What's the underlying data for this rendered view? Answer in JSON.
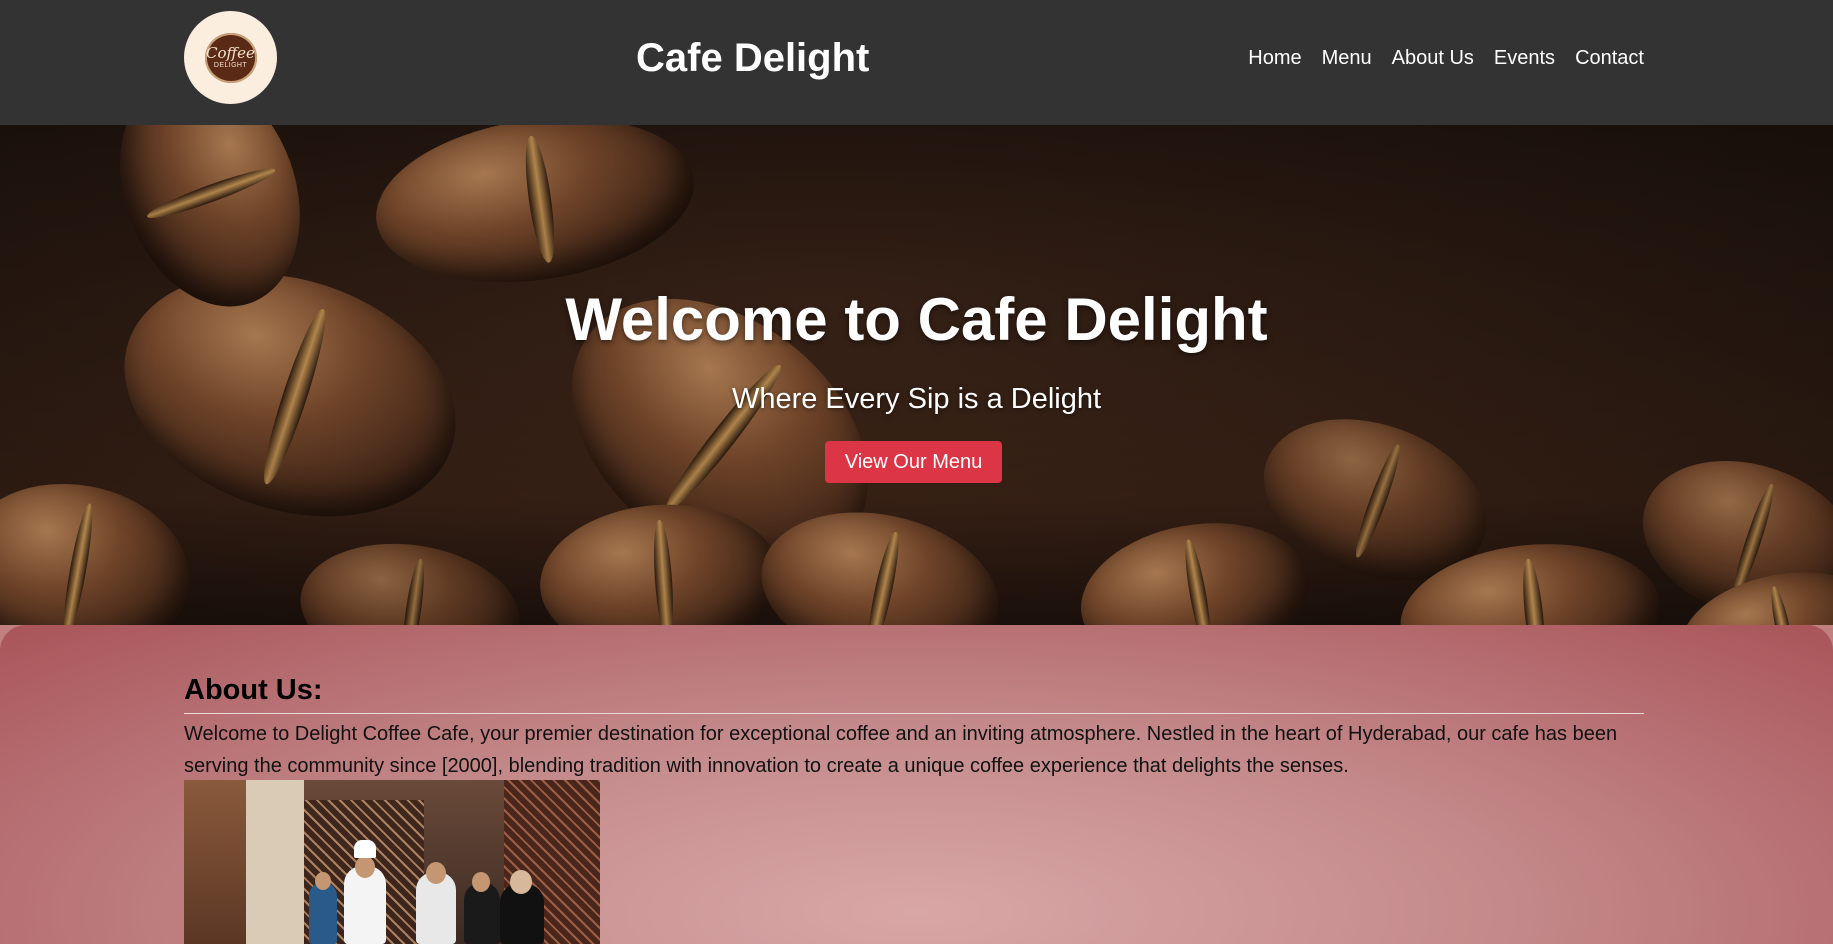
{
  "header": {
    "logo": {
      "line1": "Coffee",
      "line2": "DELIGHT"
    },
    "title": "Cafe Delight",
    "nav": [
      "Home",
      "Menu",
      "About Us",
      "Events",
      "Contact"
    ]
  },
  "hero": {
    "title": "Welcome to Cafe Delight",
    "subtitle": "Where Every Sip is a Delight",
    "button_label": "View Our Menu",
    "button_color": "#dc3545"
  },
  "about": {
    "heading": "About Us:",
    "text": "Welcome to Delight Coffee Cafe, your premier destination for exceptional coffee and an inviting atmosphere. Nestled in the heart of Hyderabad, our cafe has been serving the community since [2000], blending tradition with innovation to create a unique coffee experience that delights the senses."
  },
  "colors": {
    "header_bg": "#333333",
    "about_bg_edge": "#a95459",
    "about_bg_center": "#d9a6a6"
  }
}
